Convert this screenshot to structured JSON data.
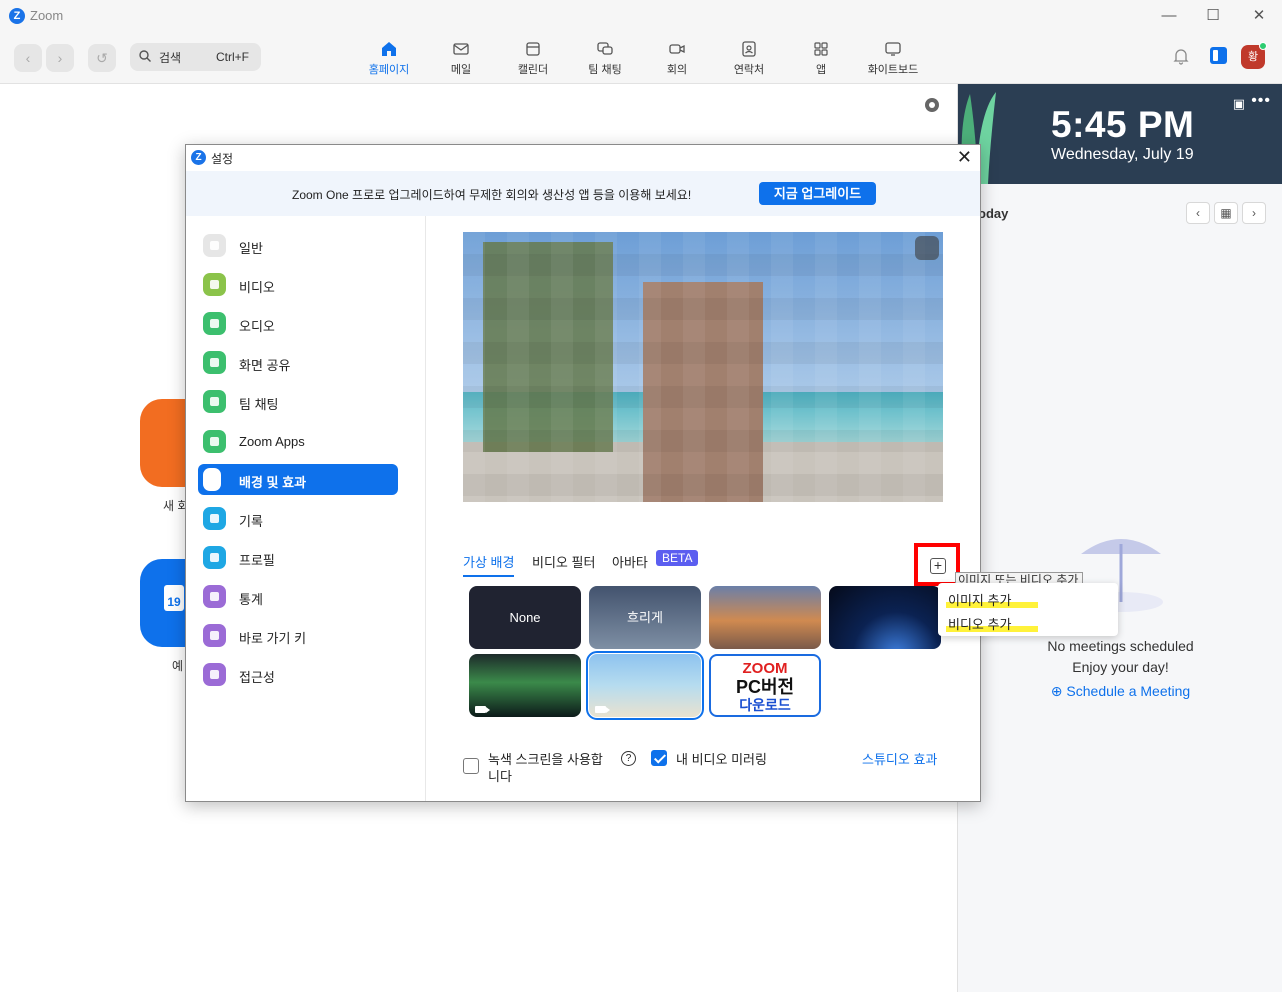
{
  "window": {
    "title": "Zoom"
  },
  "toolbar": {
    "search_label": "검색",
    "search_shortcut": "Ctrl+F",
    "tabs": [
      {
        "label": "홈페이지",
        "icon": "home-icon",
        "active": true
      },
      {
        "label": "메일",
        "icon": "mail-icon"
      },
      {
        "label": "캘린더",
        "icon": "calendar-icon"
      },
      {
        "label": "팀 채팅",
        "icon": "chat-icon"
      },
      {
        "label": "회의",
        "icon": "video-icon"
      },
      {
        "label": "연락처",
        "icon": "contacts-icon"
      },
      {
        "label": "앱",
        "icon": "apps-icon"
      },
      {
        "label": "화이트보드",
        "icon": "whiteboard-icon"
      }
    ],
    "avatar_initial": "황"
  },
  "home": {
    "new_meeting_label": "새 회",
    "schedule_label": "예",
    "calendar_day": "19"
  },
  "clock_panel": {
    "time": "5:45 PM",
    "date": "Wednesday, July 19",
    "today_label": "oday",
    "no_meetings": "No meetings scheduled",
    "enjoy": "Enjoy your day!",
    "schedule_link": "Schedule a Meeting"
  },
  "dialog": {
    "title": "설정",
    "banner_text": "Zoom One 프로로 업그레이드하여 무제한 회의와 생산성 앱 등을 이용해 보세요!",
    "upgrade_button": "지금 업그레이드",
    "sidebar": [
      {
        "label": "일반",
        "color": "#e6e6e6"
      },
      {
        "label": "비디오",
        "color": "#8bc34a"
      },
      {
        "label": "오디오",
        "color": "#3cbf6e"
      },
      {
        "label": "화면 공유",
        "color": "#3cbf6e"
      },
      {
        "label": "팀 채팅",
        "color": "#3cbf6e"
      },
      {
        "label": "Zoom Apps",
        "color": "#3cbf6e"
      },
      {
        "label": "배경 및 효과",
        "color": "#ffffff",
        "active": true
      },
      {
        "label": "기록",
        "color": "#1ea7e4"
      },
      {
        "label": "프로필",
        "color": "#1ea7e4"
      },
      {
        "label": "통계",
        "color": "#9b6bd6"
      },
      {
        "label": "바로 가기 키",
        "color": "#9b6bd6"
      },
      {
        "label": "접근성",
        "color": "#9b6bd6"
      }
    ],
    "tabs": [
      {
        "label": "가상 배경",
        "active": true
      },
      {
        "label": "비디오 필터"
      },
      {
        "label": "아바타"
      }
    ],
    "beta_badge": "BETA",
    "backgrounds": [
      {
        "label": "None",
        "bg": "#202331"
      },
      {
        "label": "흐리게",
        "bg": "linear-gradient(180deg,#43536e,#7e8fa4)"
      },
      {
        "label": "",
        "bg": "linear-gradient(180deg,#6b7fa8 0%,#d08a50 55%,#7a5a4a 100%)"
      },
      {
        "label": "",
        "bg": "radial-gradient(circle at 60% 110%, #3d7fe0 0%, #0b2252 45%, #050a1a 100%)"
      },
      {
        "label": "",
        "bg": "linear-gradient(180deg,#1d2a2a 0%,#3b8a4a 45%,#0c1a1a 100%)",
        "video": true
      },
      {
        "label": "",
        "bg": "linear-gradient(180deg,#8ec3ef 0%,#b6dcef 50%,#e9e2d0 100%)",
        "video": true,
        "selected": true
      },
      {
        "label": "",
        "bg": "#ffffff"
      }
    ],
    "zoom_promo": {
      "line1": "ZOOM",
      "line2": "PC버전",
      "line3": "다운로드"
    },
    "green_screen_label": "녹색 스크린을 사용합니다",
    "green_screen_line1": "녹색 스크린을 사용합",
    "green_screen_line2": "니다",
    "mirror_label": "내 비디오 미러링",
    "studio_effects": "스튜디오 효과",
    "help_glyph": "?"
  },
  "popup": {
    "tooltip": "이미지 또는 비디오 추가",
    "items": [
      "이미지 추가",
      "비디오 추가"
    ],
    "highlight_color": "#fff23a",
    "plus_glyph": "+"
  },
  "colors": {
    "accent": "#0e71eb",
    "orange": "#f26d21",
    "clock_bg": "#2b3e53"
  }
}
